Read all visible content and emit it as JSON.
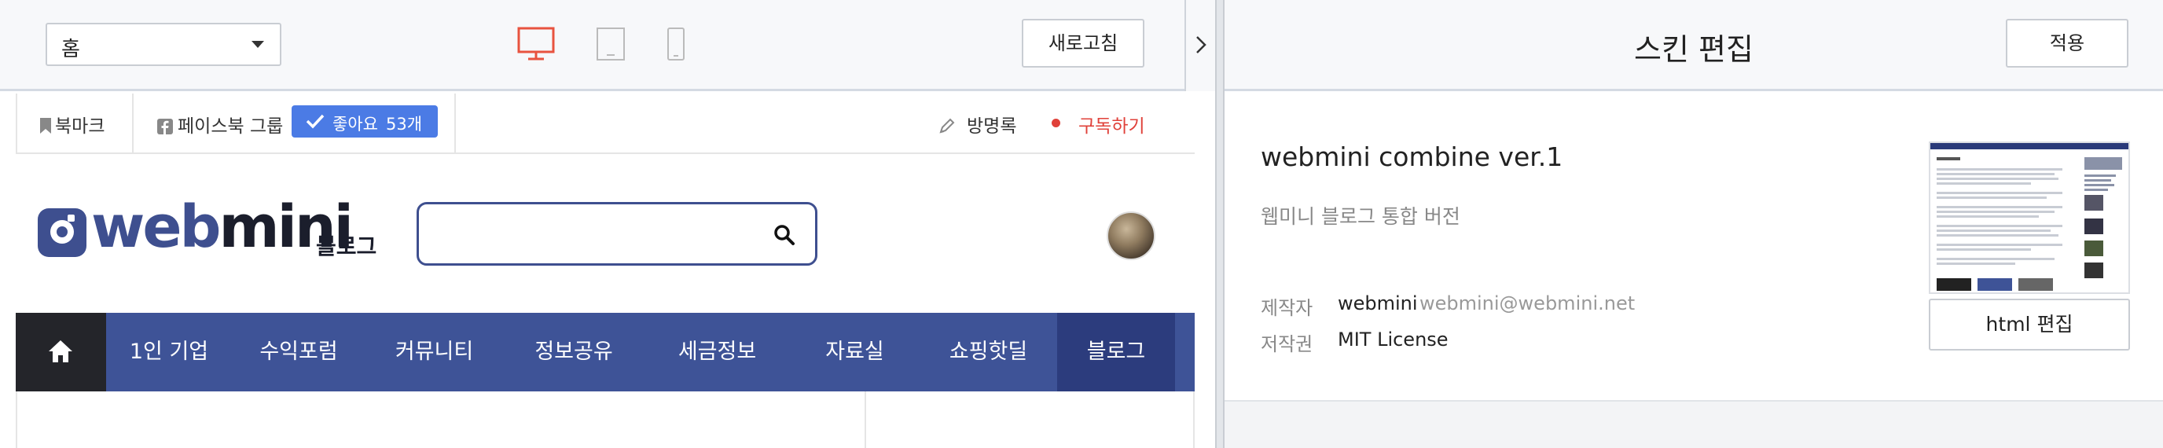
{
  "toolbar": {
    "page_select_value": "홈",
    "refresh_label": "새로고침",
    "devices": [
      "desktop-icon",
      "tablet-icon",
      "mobile-icon"
    ],
    "active_device": "desktop",
    "accent": "#e8533f"
  },
  "blog": {
    "topbar": {
      "bookmark_label": "북마크",
      "facebook_label": "페이스북 그룹",
      "like_label": "좋아요",
      "like_count": "53개",
      "guestbook_label": "방명록",
      "subscribe_label": "구독하기"
    },
    "logo_text_a": "web",
    "logo_text_b": "mini",
    "logo_sub": "블로그",
    "search_placeholder": "",
    "nav": {
      "items": [
        "1인 기업",
        "수익포럼",
        "커뮤니티",
        "정보공유",
        "세금정보",
        "자료실",
        "쇼핑핫딜",
        "블로그"
      ],
      "active_index": 7,
      "bg": "#3e5397"
    }
  },
  "skin_editor": {
    "title": "스킨 편집",
    "apply_label": "적용",
    "skin_name": "webmini combine ver.1",
    "skin_desc": "웹미니 블로그 통합 버전",
    "maker_key": "제작자",
    "maker_name": "webmini",
    "maker_email": "webmini@webmini.net",
    "license_key": "저작권",
    "license_value": "MIT License",
    "html_edit_label": "html 편집"
  }
}
